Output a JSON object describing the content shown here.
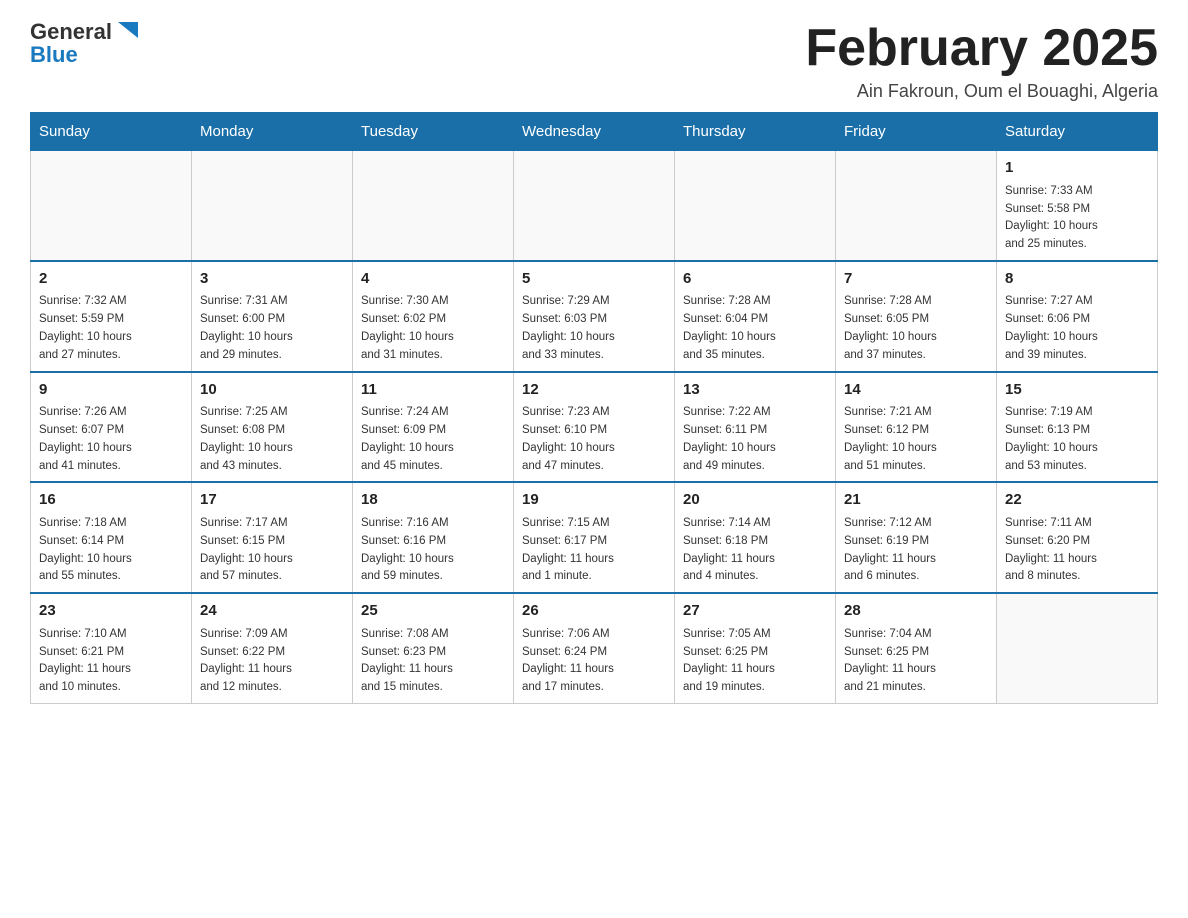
{
  "header": {
    "logo_text_black": "General",
    "logo_text_blue": "Blue",
    "month_title": "February 2025",
    "location": "Ain Fakroun, Oum el Bouaghi, Algeria"
  },
  "weekdays": [
    "Sunday",
    "Monday",
    "Tuesday",
    "Wednesday",
    "Thursday",
    "Friday",
    "Saturday"
  ],
  "weeks": [
    [
      {
        "day": "",
        "info": ""
      },
      {
        "day": "",
        "info": ""
      },
      {
        "day": "",
        "info": ""
      },
      {
        "day": "",
        "info": ""
      },
      {
        "day": "",
        "info": ""
      },
      {
        "day": "",
        "info": ""
      },
      {
        "day": "1",
        "info": "Sunrise: 7:33 AM\nSunset: 5:58 PM\nDaylight: 10 hours\nand 25 minutes."
      }
    ],
    [
      {
        "day": "2",
        "info": "Sunrise: 7:32 AM\nSunset: 5:59 PM\nDaylight: 10 hours\nand 27 minutes."
      },
      {
        "day": "3",
        "info": "Sunrise: 7:31 AM\nSunset: 6:00 PM\nDaylight: 10 hours\nand 29 minutes."
      },
      {
        "day": "4",
        "info": "Sunrise: 7:30 AM\nSunset: 6:02 PM\nDaylight: 10 hours\nand 31 minutes."
      },
      {
        "day": "5",
        "info": "Sunrise: 7:29 AM\nSunset: 6:03 PM\nDaylight: 10 hours\nand 33 minutes."
      },
      {
        "day": "6",
        "info": "Sunrise: 7:28 AM\nSunset: 6:04 PM\nDaylight: 10 hours\nand 35 minutes."
      },
      {
        "day": "7",
        "info": "Sunrise: 7:28 AM\nSunset: 6:05 PM\nDaylight: 10 hours\nand 37 minutes."
      },
      {
        "day": "8",
        "info": "Sunrise: 7:27 AM\nSunset: 6:06 PM\nDaylight: 10 hours\nand 39 minutes."
      }
    ],
    [
      {
        "day": "9",
        "info": "Sunrise: 7:26 AM\nSunset: 6:07 PM\nDaylight: 10 hours\nand 41 minutes."
      },
      {
        "day": "10",
        "info": "Sunrise: 7:25 AM\nSunset: 6:08 PM\nDaylight: 10 hours\nand 43 minutes."
      },
      {
        "day": "11",
        "info": "Sunrise: 7:24 AM\nSunset: 6:09 PM\nDaylight: 10 hours\nand 45 minutes."
      },
      {
        "day": "12",
        "info": "Sunrise: 7:23 AM\nSunset: 6:10 PM\nDaylight: 10 hours\nand 47 minutes."
      },
      {
        "day": "13",
        "info": "Sunrise: 7:22 AM\nSunset: 6:11 PM\nDaylight: 10 hours\nand 49 minutes."
      },
      {
        "day": "14",
        "info": "Sunrise: 7:21 AM\nSunset: 6:12 PM\nDaylight: 10 hours\nand 51 minutes."
      },
      {
        "day": "15",
        "info": "Sunrise: 7:19 AM\nSunset: 6:13 PM\nDaylight: 10 hours\nand 53 minutes."
      }
    ],
    [
      {
        "day": "16",
        "info": "Sunrise: 7:18 AM\nSunset: 6:14 PM\nDaylight: 10 hours\nand 55 minutes."
      },
      {
        "day": "17",
        "info": "Sunrise: 7:17 AM\nSunset: 6:15 PM\nDaylight: 10 hours\nand 57 minutes."
      },
      {
        "day": "18",
        "info": "Sunrise: 7:16 AM\nSunset: 6:16 PM\nDaylight: 10 hours\nand 59 minutes."
      },
      {
        "day": "19",
        "info": "Sunrise: 7:15 AM\nSunset: 6:17 PM\nDaylight: 11 hours\nand 1 minute."
      },
      {
        "day": "20",
        "info": "Sunrise: 7:14 AM\nSunset: 6:18 PM\nDaylight: 11 hours\nand 4 minutes."
      },
      {
        "day": "21",
        "info": "Sunrise: 7:12 AM\nSunset: 6:19 PM\nDaylight: 11 hours\nand 6 minutes."
      },
      {
        "day": "22",
        "info": "Sunrise: 7:11 AM\nSunset: 6:20 PM\nDaylight: 11 hours\nand 8 minutes."
      }
    ],
    [
      {
        "day": "23",
        "info": "Sunrise: 7:10 AM\nSunset: 6:21 PM\nDaylight: 11 hours\nand 10 minutes."
      },
      {
        "day": "24",
        "info": "Sunrise: 7:09 AM\nSunset: 6:22 PM\nDaylight: 11 hours\nand 12 minutes."
      },
      {
        "day": "25",
        "info": "Sunrise: 7:08 AM\nSunset: 6:23 PM\nDaylight: 11 hours\nand 15 minutes."
      },
      {
        "day": "26",
        "info": "Sunrise: 7:06 AM\nSunset: 6:24 PM\nDaylight: 11 hours\nand 17 minutes."
      },
      {
        "day": "27",
        "info": "Sunrise: 7:05 AM\nSunset: 6:25 PM\nDaylight: 11 hours\nand 19 minutes."
      },
      {
        "day": "28",
        "info": "Sunrise: 7:04 AM\nSunset: 6:25 PM\nDaylight: 11 hours\nand 21 minutes."
      },
      {
        "day": "",
        "info": ""
      }
    ]
  ]
}
